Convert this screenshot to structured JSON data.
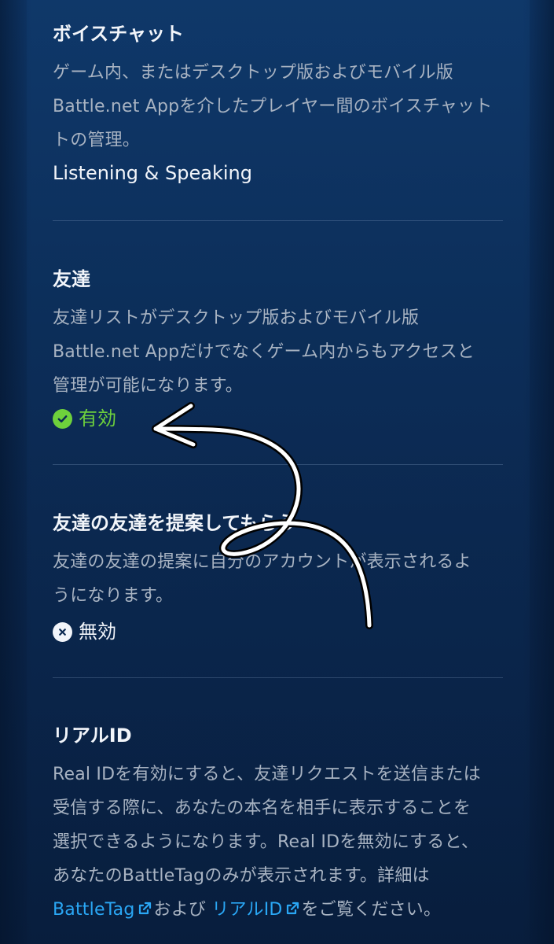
{
  "sections": {
    "voice_chat": {
      "title": "ボイスチャット",
      "desc_lines": [
        "ゲーム内、またはデスクトップ版およびモバイル版",
        "Battle.net Appを介したプレイヤー間のボイスチャット",
        "トの管理。"
      ],
      "value": "Listening & Speaking"
    },
    "friends": {
      "title": "友達",
      "desc_lines": [
        "友達リストがデスクトップ版およびモバイル版",
        "Battle.net Appだけでなくゲーム内からもアクセスと",
        "管理が可能になります。"
      ],
      "status_label": "有効",
      "status_color": "#6ed13c"
    },
    "friend_suggestions": {
      "title": "友達の友達を提案してもらう",
      "desc_lines": [
        "友達の友達の提案に自分のアカウントが表示されるよ",
        "うになります。"
      ],
      "status_label": "無効"
    },
    "real_id": {
      "title": "リアルID",
      "desc_lines": [
        "Real IDを有効にすると、友達リクエストを送信または",
        "受信する際に、あなたの本名を相手に表示することを",
        "選択できるようになります。Real IDを無効にすると、",
        "あなたのBattleTagのみが表示されます。詳細は"
      ],
      "link_battletag": "BattleTag",
      "text_and": "および ",
      "link_realid": "リアルID",
      "text_end": "をご覧ください。"
    }
  },
  "colors": {
    "enabled": "#6ed13c",
    "link": "#2aa7f5",
    "annotation_stroke": "#ffffff"
  }
}
